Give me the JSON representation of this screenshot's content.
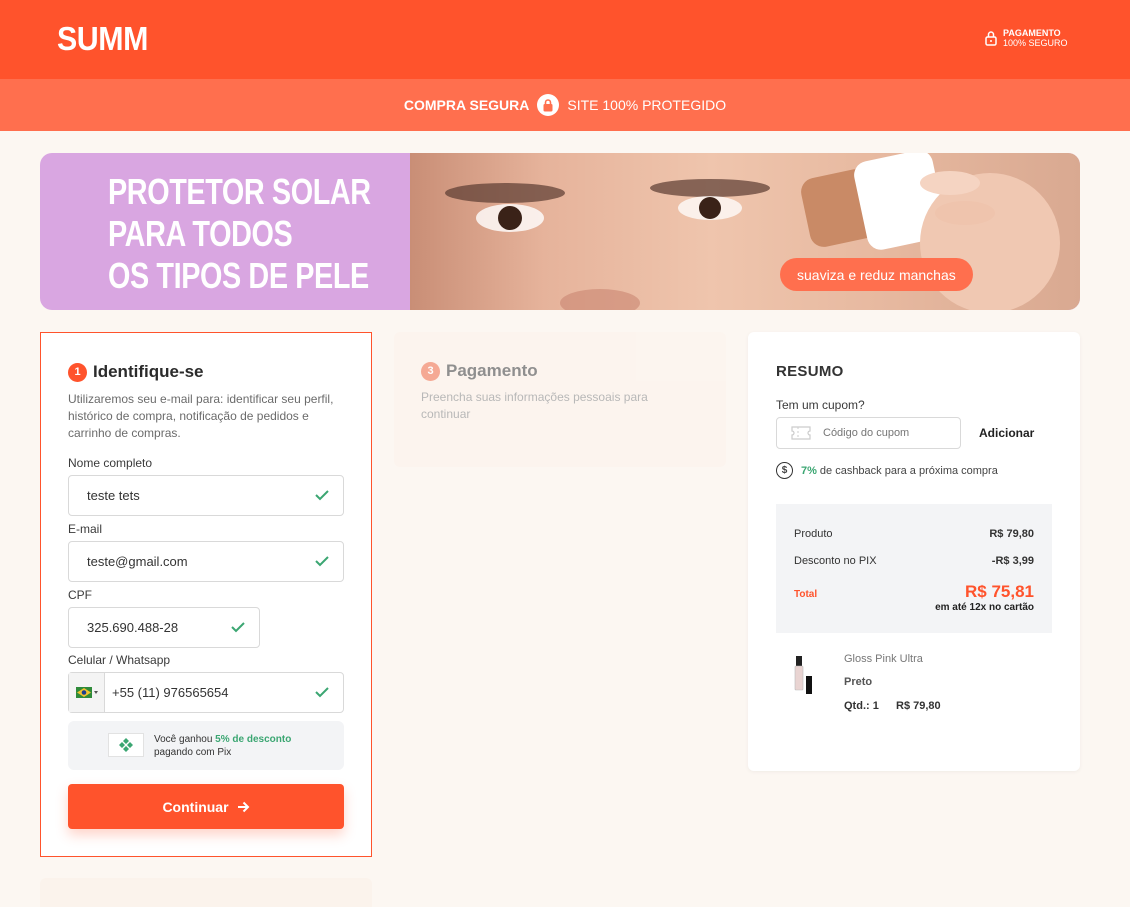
{
  "header": {
    "logo": "SUMM",
    "secure_line1": "PAGAMENTO",
    "secure_line2": "100% SEGURO"
  },
  "subbar": {
    "bold": "COMPRA SEGURA",
    "text": "SITE 100% PROTEGIDO"
  },
  "banner": {
    "line1": "PROTETOR SOLAR",
    "line2": "PARA TODOS",
    "line3": "OS TIPOS DE PELE",
    "pill": "suaviza e reduz manchas"
  },
  "identify": {
    "step": "1",
    "title": "Identifique-se",
    "description": "Utilizaremos seu e-mail para: identificar seu perfil, histórico de compra, notificação de pedidos e carrinho de compras.",
    "name_label": "Nome completo",
    "name_value": "teste tets",
    "email_label": "E-mail",
    "email_value": "teste@gmail.com",
    "cpf_label": "CPF",
    "cpf_value": "325.690.488-28",
    "phone_label": "Celular / Whatsapp",
    "phone_value": "+55 (11) 976565654",
    "promo_prefix": "Você ganhou ",
    "promo_highlight": "5% de desconto",
    "promo_suffix": "pagando com Pix",
    "continue_label": "Continuar"
  },
  "payment": {
    "step": "3",
    "title": "Pagamento",
    "description": "Preencha suas informações pessoais para continuar"
  },
  "summary": {
    "title": "RESUMO",
    "coupon_label": "Tem um cupom?",
    "coupon_placeholder": "Código do cupom",
    "add_label": "Adicionar",
    "cashback_pct": "7%",
    "cashback_text": "de cashback para a próxima compra",
    "product_label": "Produto",
    "product_value": "R$ 79,80",
    "discount_label": "Desconto no PIX",
    "discount_value": "-R$ 3,99",
    "total_label": "Total",
    "total_value": "R$ 75,81",
    "installments": "em até 12x no cartão",
    "item": {
      "name": "Gloss Pink Ultra",
      "variant": "Preto",
      "qty": "Qtd.: 1",
      "price": "R$ 79,80"
    }
  },
  "colors": {
    "brand": "#ff532c",
    "success": "#3ba672"
  }
}
